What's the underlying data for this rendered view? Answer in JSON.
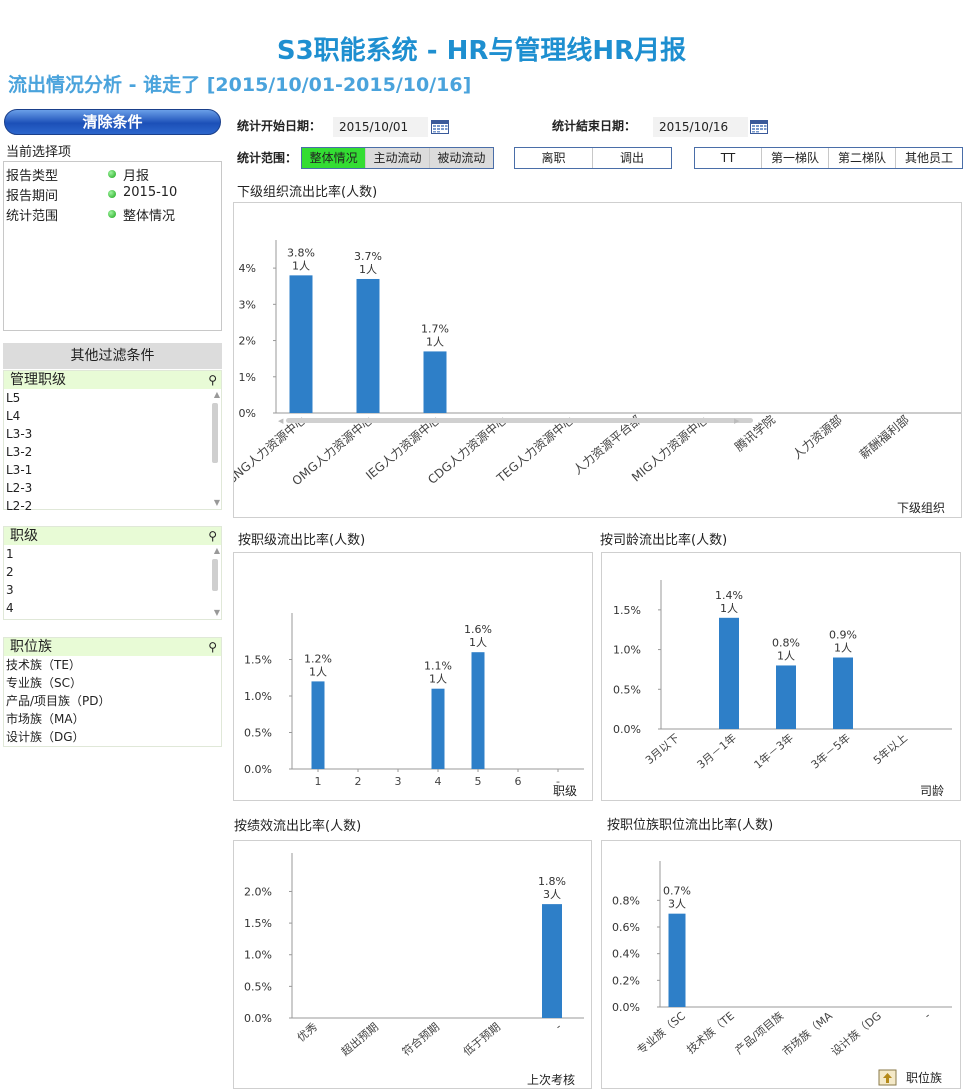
{
  "header": {
    "title": "S3职能系统 - HR与管理线HR月报",
    "subtitle": "流出情况分析 - 谁走了 [2015/10/01-2015/10/16]"
  },
  "left": {
    "clear_button": "清除条件",
    "current_label": "当前选择项",
    "current_selections": [
      {
        "key": "报告类型",
        "value": "月报"
      },
      {
        "key": "报告期间",
        "value": "2015-10"
      },
      {
        "key": "统计范围",
        "value": "整体情况"
      }
    ],
    "other_filters": "其他过滤条件",
    "lists": [
      {
        "title": "管理职级",
        "items": [
          "L5",
          "L4",
          "L3-3",
          "L3-2",
          "L3-1",
          "L2-3",
          "L2-2"
        ]
      },
      {
        "title": "职级",
        "items": [
          "1",
          "2",
          "3",
          "4"
        ]
      },
      {
        "title": "职位族",
        "items": [
          "技术族（TE）",
          "专业族（SC）",
          "产品/项目族（PD）",
          "市场族（MA）",
          "设计族（DG）"
        ]
      }
    ],
    "dot_color": "#22aa22"
  },
  "filters": {
    "start_label": "统计开始日期：",
    "start_value": "2015/10/01",
    "end_label": "统计結束日期：",
    "end_value": "2015/10/16",
    "scope_label": "统计范围：",
    "scope_options": [
      "整体情况",
      "主动流动",
      "被动流动"
    ],
    "scope_selected": "整体情况",
    "type_options": [
      "离职",
      "调出"
    ],
    "group_options": [
      "TT",
      "第一梯队",
      "第二梯队",
      "其他员工"
    ],
    "active_color": "#33dd33"
  },
  "chart_data": [
    {
      "id": "org",
      "type": "bar",
      "title": "下级组织流出比率(人数)",
      "xlabel": "下级组织",
      "categories": [
        "SNG人力资源中心",
        "OMG人力资源中心",
        "IEG人力资源中心",
        "CDG人力资源中心",
        "TEG人力资源中心",
        "人力资源平台部",
        "MIG人力资源中心",
        "腾讯学院",
        "人力资源部",
        "薪酬福利部"
      ],
      "values": [
        3.8,
        3.7,
        1.7,
        null,
        null,
        null,
        null,
        null,
        null,
        null
      ],
      "labels": [
        "3.8%",
        "3.7%",
        "1.7%"
      ],
      "counts": [
        "1人",
        "1人",
        "1人"
      ],
      "yticks": [
        "0%",
        "1%",
        "2%",
        "3%",
        "4%"
      ],
      "ylim": [
        0,
        4.5
      ],
      "color": "#2e7fc8"
    },
    {
      "id": "grade",
      "type": "bar",
      "title": "按职级流出比率(人数)",
      "xlabel": "职级",
      "categories": [
        "1",
        "2",
        "3",
        "4",
        "5",
        "6",
        "-"
      ],
      "values": [
        1.2,
        null,
        null,
        1.1,
        1.6,
        null,
        null
      ],
      "labels": [
        "1.2%",
        "",
        "",
        "1.1%",
        "1.6%"
      ],
      "counts": [
        "1人",
        "",
        "",
        "1人",
        "1人"
      ],
      "yticks": [
        "0.0%",
        "0.5%",
        "1.0%",
        "1.5%"
      ],
      "ylim": [
        0,
        2.0
      ],
      "color": "#2e7fc8"
    },
    {
      "id": "tenure",
      "type": "bar",
      "title": "按司龄流出比率(人数)",
      "xlabel": "司龄",
      "categories": [
        "3月以下",
        "3月－1年",
        "1年－3年",
        "3年－5年",
        "5年以上"
      ],
      "values": [
        null,
        1.4,
        0.8,
        0.9,
        null
      ],
      "labels": [
        "",
        "1.4%",
        "0.8%",
        "0.9%"
      ],
      "counts": [
        "",
        "1人",
        "1人",
        "1人"
      ],
      "yticks": [
        "0.0%",
        "0.5%",
        "1.0%",
        "1.5%"
      ],
      "ylim": [
        0,
        1.75
      ],
      "color": "#2e7fc8"
    },
    {
      "id": "perf",
      "type": "bar",
      "title": "按绩效流出比率(人数)",
      "xlabel": "上次考核",
      "categories": [
        "优秀",
        "超出预期",
        "符合预期",
        "低于预期",
        "-"
      ],
      "values": [
        null,
        null,
        null,
        null,
        1.8
      ],
      "labels": [
        "",
        "",
        "",
        "",
        "1.8%"
      ],
      "counts": [
        "",
        "",
        "",
        "",
        "3人"
      ],
      "yticks": [
        "0.0%",
        "0.5%",
        "1.0%",
        "1.5%",
        "2.0%"
      ],
      "ylim": [
        0,
        2.45
      ],
      "color": "#2e7fc8"
    },
    {
      "id": "family",
      "type": "bar",
      "title": "按职位族职位流出比率(人数)",
      "xlabel": "职位族",
      "categories": [
        "专业族（SC",
        "技术族（TE",
        "产品/项目族",
        "市场族（MA",
        "设计族（DG",
        "-"
      ],
      "values": [
        0.7,
        null,
        null,
        null,
        null,
        null
      ],
      "labels": [
        "0.7%"
      ],
      "counts": [
        "3人"
      ],
      "yticks": [
        "0.0%",
        "0.2%",
        "0.4%",
        "0.6%",
        "0.8%"
      ],
      "ylim": [
        0,
        1.02
      ],
      "color": "#2e7fc8"
    }
  ]
}
